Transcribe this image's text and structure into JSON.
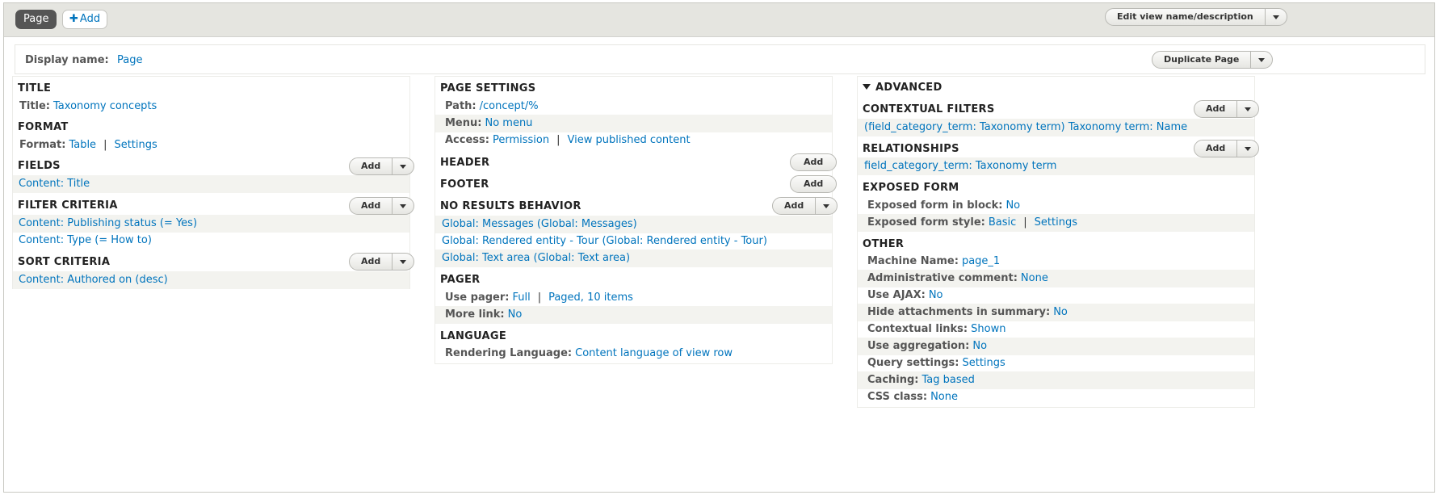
{
  "tabs": {
    "page": "Page",
    "add": "Add"
  },
  "edit_view_btn": "Edit view name/description",
  "display": {
    "label": "Display name:",
    "value": "Page",
    "duplicate_btn": "Duplicate Page"
  },
  "add_label": "Add",
  "left": {
    "title_h": "TITLE",
    "title_k": "Title:",
    "title_v": "Taxonomy concepts",
    "format_h": "FORMAT",
    "format_k": "Format:",
    "format_v": "Table",
    "format_settings": "Settings",
    "fields_h": "FIELDS",
    "fields_items": [
      "Content: Title"
    ],
    "filter_h": "FILTER CRITERIA",
    "filter_items": [
      "Content: Publishing status (= Yes)",
      "Content: Type (= How to)"
    ],
    "sort_h": "SORT CRITERIA",
    "sort_items": [
      "Content: Authored on (desc)"
    ]
  },
  "middle": {
    "page_settings_h": "PAGE SETTINGS",
    "path_k": "Path:",
    "path_v": "/concept/%",
    "menu_k": "Menu:",
    "menu_v": "No menu",
    "access_k": "Access:",
    "access_v": "Permission",
    "access_v2": "View published content",
    "header_h": "HEADER",
    "footer_h": "FOOTER",
    "noresults_h": "NO RESULTS BEHAVIOR",
    "noresults_items": [
      "Global: Messages (Global: Messages)",
      "Global: Rendered entity - Tour (Global: Rendered entity - Tour)",
      "Global: Text area (Global: Text area)"
    ],
    "pager_h": "PAGER",
    "pager_k": "Use pager:",
    "pager_v": "Full",
    "pager_v2": "Paged, 10 items",
    "more_k": "More link:",
    "more_v": "No",
    "language_h": "LANGUAGE",
    "lang_k": "Rendering Language:",
    "lang_v": "Content language of view row"
  },
  "right": {
    "advanced_h": "ADVANCED",
    "ctx_h": "CONTEXTUAL FILTERS",
    "ctx_items": [
      "(field_category_term: Taxonomy term) Taxonomy term: Name"
    ],
    "rel_h": "RELATIONSHIPS",
    "rel_items": [
      "field_category_term: Taxonomy term"
    ],
    "exposed_h": "EXPOSED FORM",
    "exp_block_k": "Exposed form in block:",
    "exp_block_v": "No",
    "exp_style_k": "Exposed form style:",
    "exp_style_v": "Basic",
    "exp_style_settings": "Settings",
    "other_h": "OTHER",
    "other_rows": [
      {
        "k": "Machine Name:",
        "v": "page_1"
      },
      {
        "k": "Administrative comment:",
        "v": "None"
      },
      {
        "k": "Use AJAX:",
        "v": "No"
      },
      {
        "k": "Hide attachments in summary:",
        "v": "No"
      },
      {
        "k": "Contextual links:",
        "v": "Shown"
      },
      {
        "k": "Use aggregation:",
        "v": "No"
      },
      {
        "k": "Query settings:",
        "v": "Settings"
      },
      {
        "k": "Caching:",
        "v": "Tag based"
      },
      {
        "k": "CSS class:",
        "v": "None"
      }
    ]
  }
}
